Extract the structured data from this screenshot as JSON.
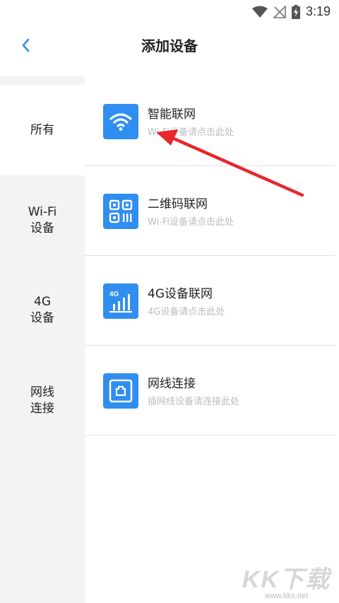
{
  "status_bar": {
    "time": "3:19",
    "icons": [
      "wifi-icon",
      "no-signal-icon",
      "battery-charging-icon"
    ]
  },
  "header": {
    "title": "添加设备",
    "back_icon": "chevron-left-icon"
  },
  "colors": {
    "accent": "#2f8ef0",
    "annotation": "#e8262b"
  },
  "sidebar": {
    "items": [
      {
        "label": "所有",
        "active": true
      },
      {
        "label": "Wi-Fi\n设备",
        "active": false
      },
      {
        "label": "4G\n设备",
        "active": false
      },
      {
        "label": "网线\n连接",
        "active": false
      }
    ]
  },
  "methods": [
    {
      "title": "智能联网",
      "subtitle": "Wi-Fi设备请点击此处",
      "icon": "wifi-icon"
    },
    {
      "title": "二维码联网",
      "subtitle": "Wi-Fi设备请点击此处",
      "icon": "qr-code-icon"
    },
    {
      "title": "4G设备联网",
      "subtitle": "4G设备请点击此处",
      "icon": "signal-4g-icon"
    },
    {
      "title": "网线连接",
      "subtitle": "插网线设备请连接此处",
      "icon": "ethernet-port-icon"
    }
  ],
  "watermark": {
    "logo": "KK下载",
    "url": "www.kkx.net"
  }
}
